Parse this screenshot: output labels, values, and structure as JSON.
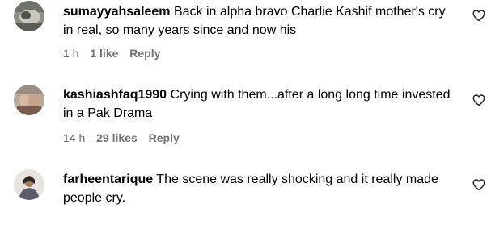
{
  "comments": [
    {
      "username": "sumayyahsaleem",
      "text": "Back in alpha bravo Charlie Kashif mother's cry in real, so many years since and now his",
      "time": "1 h",
      "likes": "1 like",
      "reply": "Reply"
    },
    {
      "username": "kashiashfaq1990",
      "text": "Crying with them...after a long long time invested in a Pak Drama",
      "time": "14 h",
      "likes": "29 likes",
      "reply": "Reply"
    },
    {
      "username": "farheentarique",
      "text": "The scene was really shocking and it really made people cry.",
      "time": "",
      "likes": "",
      "reply": ""
    }
  ],
  "icons": {
    "like": "heart-outline-icon"
  },
  "colors": {
    "meta_text": "#737373",
    "text": "#000000",
    "background": "#ffffff"
  }
}
